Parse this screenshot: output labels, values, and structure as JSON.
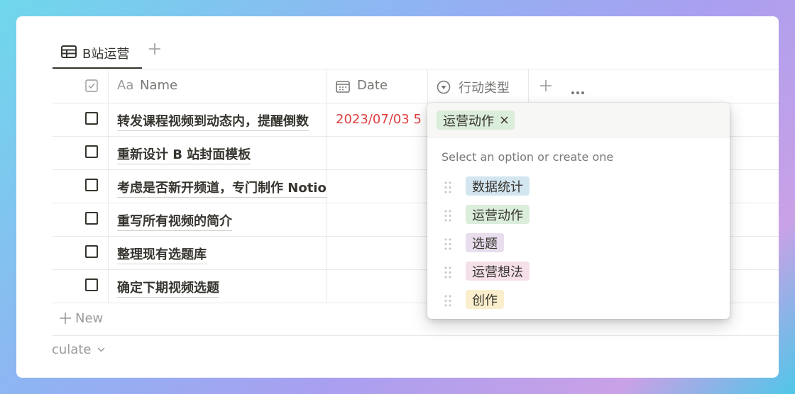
{
  "tab": {
    "label": "B站运营",
    "icon": "table-icon",
    "add_icon": "plus-icon"
  },
  "columns": {
    "check_icon": "checkbox-icon",
    "name_prefix": "Aa",
    "name": "Name",
    "date": "Date",
    "type": "行动类型",
    "add_icon": "plus-icon",
    "more_icon": "more-icon"
  },
  "rows": [
    {
      "name": "转发课程视频到动态内，提醒倒数",
      "date": "2023/07/03 5"
    },
    {
      "name": "重新设计 B 站封面模板",
      "date": ""
    },
    {
      "name": "考虑是否新开频道，专门制作 Notion",
      "date": ""
    },
    {
      "name": "重写所有视频的简介",
      "date": ""
    },
    {
      "name": "整理现有选题库",
      "date": ""
    },
    {
      "name": "确定下期视频选题",
      "date": ""
    }
  ],
  "new_row": {
    "label": "New"
  },
  "calculate": {
    "label": "culate"
  },
  "popup": {
    "selected": {
      "label": "运营动作",
      "color": "#dbeddb"
    },
    "hint": "Select an option or create one",
    "options": [
      {
        "label": "数据统计",
        "color": "#d3e5ef"
      },
      {
        "label": "运营动作",
        "color": "#dbeddb"
      },
      {
        "label": "选题",
        "color": "#e8deee"
      },
      {
        "label": "运营想法",
        "color": "#f5e0e9"
      },
      {
        "label": "创作",
        "color": "#fbeecc"
      }
    ]
  }
}
